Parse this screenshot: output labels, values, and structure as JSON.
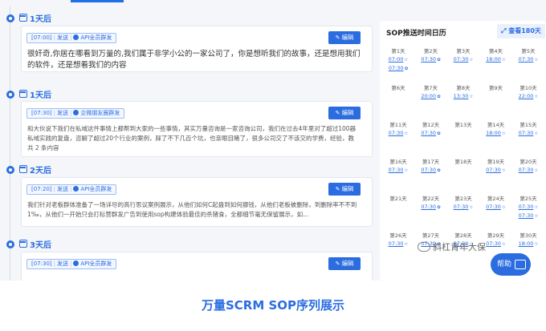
{
  "timeline": [
    {
      "day": "1天后",
      "tag": {
        "time": "[07:00]",
        "type": "发送",
        "target": "API全员群发"
      },
      "edit_label": "编辑",
      "content": "很奸奇,你居在哪看到万量的,我们属于非学小公的一家公司了，你是想听我们的故事，还是想用我们的软件，还是想看我们的内容",
      "extra": ""
    },
    {
      "day": "1天后",
      "tag": {
        "time": "[07:30]",
        "type": "发送",
        "target": "企微朋友圈群发"
      },
      "edit_label": "编辑",
      "content": "和大伙说下我们在私域这件事情上都帮到大家的一些事情，其实万量咨询是一家咨询公司，我们在过去4年里对了超过100器私域实践的复盘，咨解了超过20个行业的案例，踩了不下几百个坑，也亲眼目睹了，很多公司交了不该交的学费，经验，教训，复盘等...",
      "extra": "共 2 条内容"
    },
    {
      "day": "2天后",
      "tag": {
        "time": "[07:20]",
        "type": "发送",
        "target": "API全员群发"
      },
      "edit_label": "编辑",
      "content": "我们针对老板群体准备了一场详尽的高行思议案例展示，从他们如何C起盘到如何挪钱，从他们老板被删除，到删除率不不到1‰，从他们一开始只会打标营群发广告到使用sop构建体验最佳的杀猪食，全都细节毫无保留展示，如...",
      "extra": ""
    },
    {
      "day": "3天后",
      "tag": {
        "time": "[07:30]",
        "type": "发送",
        "target": "API全员群发"
      },
      "edit_label": "编辑",
      "content": "",
      "extra": ""
    }
  ],
  "calendar": {
    "title": "SOP推送时间日历",
    "view_label": "查看180天",
    "days": [
      {
        "name": "第1天",
        "times": [
          "07:00",
          "07:30"
        ]
      },
      {
        "name": "第2天",
        "times": [
          "07:30"
        ]
      },
      {
        "name": "第3天",
        "times": [
          "07:30"
        ]
      },
      {
        "name": "第4天",
        "times": [
          "18:00"
        ]
      },
      {
        "name": "第5天",
        "times": [
          "07:30"
        ]
      },
      {
        "name": "第6天",
        "times": []
      },
      {
        "name": "第7天",
        "times": [
          "20:00"
        ]
      },
      {
        "name": "第8天",
        "times": [
          "13:30"
        ]
      },
      {
        "name": "第9天",
        "times": []
      },
      {
        "name": "第10天",
        "times": [
          "22:00"
        ]
      },
      {
        "name": "第11天",
        "times": [
          "07:30"
        ]
      },
      {
        "name": "第12天",
        "times": [
          "07:30"
        ]
      },
      {
        "name": "第13天",
        "times": []
      },
      {
        "name": "第14天",
        "times": [
          "18:00"
        ]
      },
      {
        "name": "第15天",
        "times": [
          "07:30"
        ]
      },
      {
        "name": "第16天",
        "times": [
          "07:30"
        ]
      },
      {
        "name": "第17天",
        "times": [
          "07:30"
        ]
      },
      {
        "name": "第18天",
        "times": []
      },
      {
        "name": "第19天",
        "times": [
          "07:30"
        ]
      },
      {
        "name": "第20天",
        "times": [
          "07:30"
        ]
      },
      {
        "name": "第21天",
        "times": []
      },
      {
        "name": "第22天",
        "times": [
          "07:30"
        ]
      },
      {
        "name": "第23天",
        "times": [
          "07:30"
        ]
      },
      {
        "name": "第24天",
        "times": [
          "07:30"
        ]
      },
      {
        "name": "第25天",
        "times": [
          "07:30",
          "07:30"
        ]
      },
      {
        "name": "第26天",
        "times": [
          "07:30"
        ]
      },
      {
        "name": "第27天",
        "times": [
          "07:30"
        ]
      },
      {
        "name": "第28天",
        "times": [
          "07:30"
        ]
      },
      {
        "name": "第29天",
        "times": [
          "07:30"
        ]
      },
      {
        "name": "第30天",
        "times": [
          "18:00"
        ]
      }
    ]
  },
  "help_label": "帮助",
  "watermark": "斜杠青年大保",
  "caption": "万量SCRM SOP序列展示"
}
